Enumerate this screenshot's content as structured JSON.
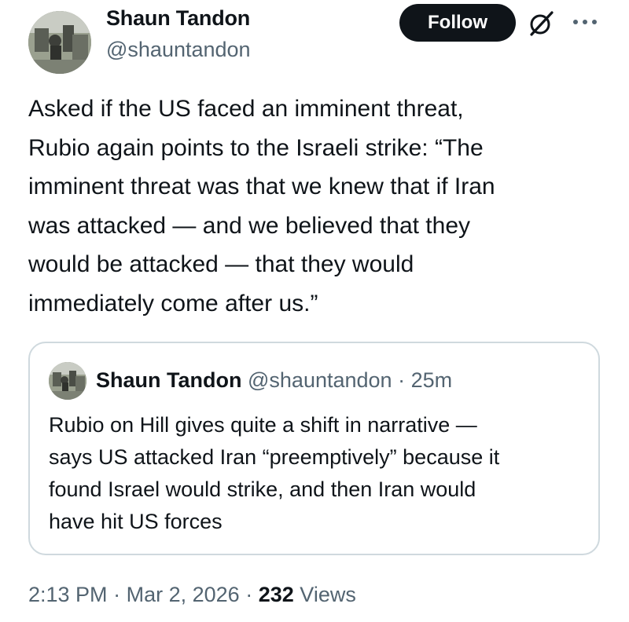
{
  "author": {
    "display_name": "Shaun Tandon",
    "handle": "@shauntandon",
    "avatar_icon": "profile-photo"
  },
  "actions": {
    "follow_label": "Follow",
    "grok_icon": "grok-icon",
    "more_icon": "more-horizontal-icon"
  },
  "tweet": {
    "text": "Asked if the US faced an imminent threat,\nRubio again points to the Israeli strike: “The\nimminent threat was that we knew that if Iran\nwas attacked — and we believed that they\nwould be attacked — that they would\nimmediately come after us.”"
  },
  "quoted_tweet": {
    "display_name": "Shaun Tandon",
    "handle": "@shauntandon",
    "separator": "·",
    "time_ago": "25m",
    "text": "Rubio on Hill gives quite a shift in narrative —\nsays US attacked Iran “preemptively” because it\nfound Israel would strike, and then Iran would\nhave hit US forces"
  },
  "meta": {
    "time": "2:13 PM",
    "separator": "·",
    "date": "Mar 2, 2026",
    "views_count": "232",
    "views_label": "Views"
  },
  "colors": {
    "text": "#0f1419",
    "muted": "#536471",
    "border": "#cfd9de",
    "button_bg": "#0f1419"
  }
}
